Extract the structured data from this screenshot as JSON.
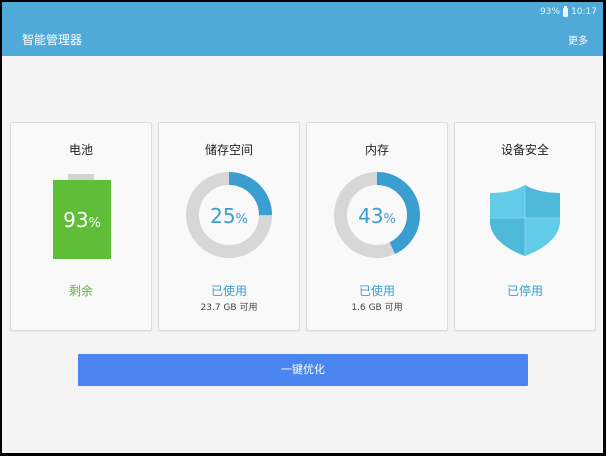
{
  "status_bar": {
    "battery": "93%",
    "time": "10:17"
  },
  "header": {
    "title": "智能管理器",
    "more_label": "更多"
  },
  "cards": {
    "battery": {
      "title": "电池",
      "value": "93",
      "unit": "%",
      "status": "剩余",
      "level": 0.93
    },
    "storage": {
      "title": "储存空间",
      "value": "25",
      "unit": "%",
      "status": "已使用",
      "detail": "23.7 GB 可用",
      "fraction": 0.25
    },
    "memory": {
      "title": "内存",
      "value": "43",
      "unit": "%",
      "status": "已使用",
      "detail": "1.6 GB 可用",
      "fraction": 0.43
    },
    "security": {
      "title": "设备安全",
      "status": "已停用"
    }
  },
  "actions": {
    "optimize_label": "一键优化"
  },
  "colors": {
    "header_bg": "#4fa9d9",
    "battery_green": "#5fbe38",
    "accent_blue": "#3a9fd0",
    "ring_track": "#d7d7d7",
    "button_blue": "#4b86f0",
    "shield_light": "#61cbe8",
    "shield_dark": "#4db8d8"
  }
}
